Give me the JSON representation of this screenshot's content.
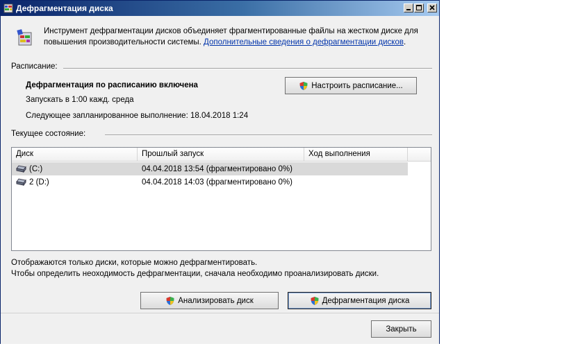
{
  "window": {
    "title": "Дефрагментация диска"
  },
  "intro": {
    "text": "Инструмент дефрагментации дисков объединяет фрагментированные файлы на жестком диске для повышения производительности системы. ",
    "link": "Дополнительные сведения о дефрагментации дисков",
    "trailing": "."
  },
  "schedule": {
    "section_label": "Расписание:",
    "status": "Дефрагментация по расписанию включена",
    "run_at": "Запускать в 1:00 кажд. среда",
    "next_run": "Следующее запланированное выполнение: 18.04.2018 1:24",
    "configure_button": "Настроить расписание..."
  },
  "current_state": {
    "section_label": "Текущее состояние:",
    "columns": [
      "Диск",
      "Прошлый запуск",
      "Ход выполнения"
    ],
    "rows": [
      {
        "disk": "(C:)",
        "last_run": "04.04.2018 13:54 (фрагментировано 0%)",
        "progress": ""
      },
      {
        "disk": "2 (D:)",
        "last_run": "04.04.2018 14:03 (фрагментировано 0%)",
        "progress": ""
      }
    ]
  },
  "notes": {
    "line1": "Отображаются только диски, которые можно дефрагментировать.",
    "line2": "Чтобы определить неоходимость  дефрагментации, сначала необходимо проанализировать диски."
  },
  "actions": {
    "analyze": "Анализировать диск",
    "defrag": "Дефрагментация диска",
    "close": "Закрыть"
  },
  "icons": {
    "app": "defrag-app-icon",
    "shield": "uac-shield-icon",
    "drive": "hard-drive-icon"
  },
  "colors": {
    "titlebar": "#0a246a",
    "link": "#0033aa",
    "selected_row": "#d9d9d9"
  }
}
